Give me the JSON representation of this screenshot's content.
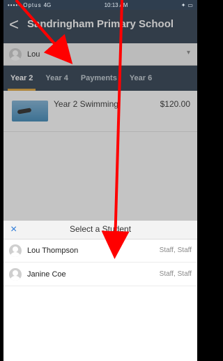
{
  "status": {
    "carrier": "••••• Optus",
    "network": "4G",
    "time": "10:13 AM"
  },
  "header": {
    "back_label": "<",
    "title": "Sandringham Primary School"
  },
  "student_picker": {
    "selected": "Lou",
    "chevron": "▾"
  },
  "tabs": [
    "Year 2",
    "Year 4",
    "Payments",
    "Year 6"
  ],
  "item": {
    "title": "Year 2 Swimming",
    "price": "$120.00"
  },
  "sheet": {
    "close_label": "×",
    "title": "Select a Student",
    "students": [
      {
        "name": "Lou Thompson",
        "role": "Staff, Staff"
      },
      {
        "name": "Janine Coe",
        "role": "Staff, Staff"
      }
    ]
  }
}
